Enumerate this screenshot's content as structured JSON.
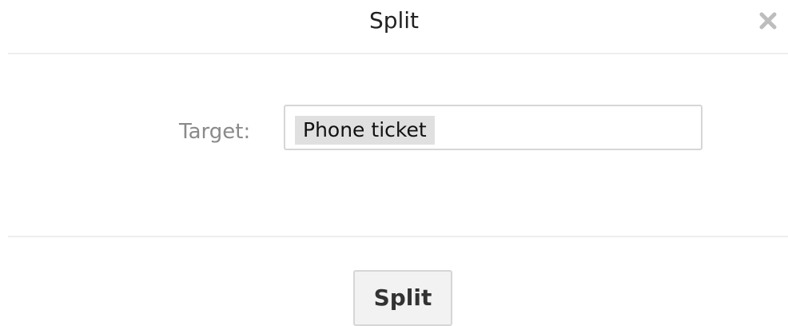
{
  "dialog": {
    "title": "Split",
    "close_icon": "close-icon"
  },
  "form": {
    "target_label": "Target:",
    "target_value": "Phone ticket"
  },
  "footer": {
    "submit_label": "Split"
  },
  "colors": {
    "divider": "#eeeeee",
    "label_text": "#8a8a8a",
    "token_background": "#e0e0e0",
    "button_background": "#f2f2f2"
  }
}
